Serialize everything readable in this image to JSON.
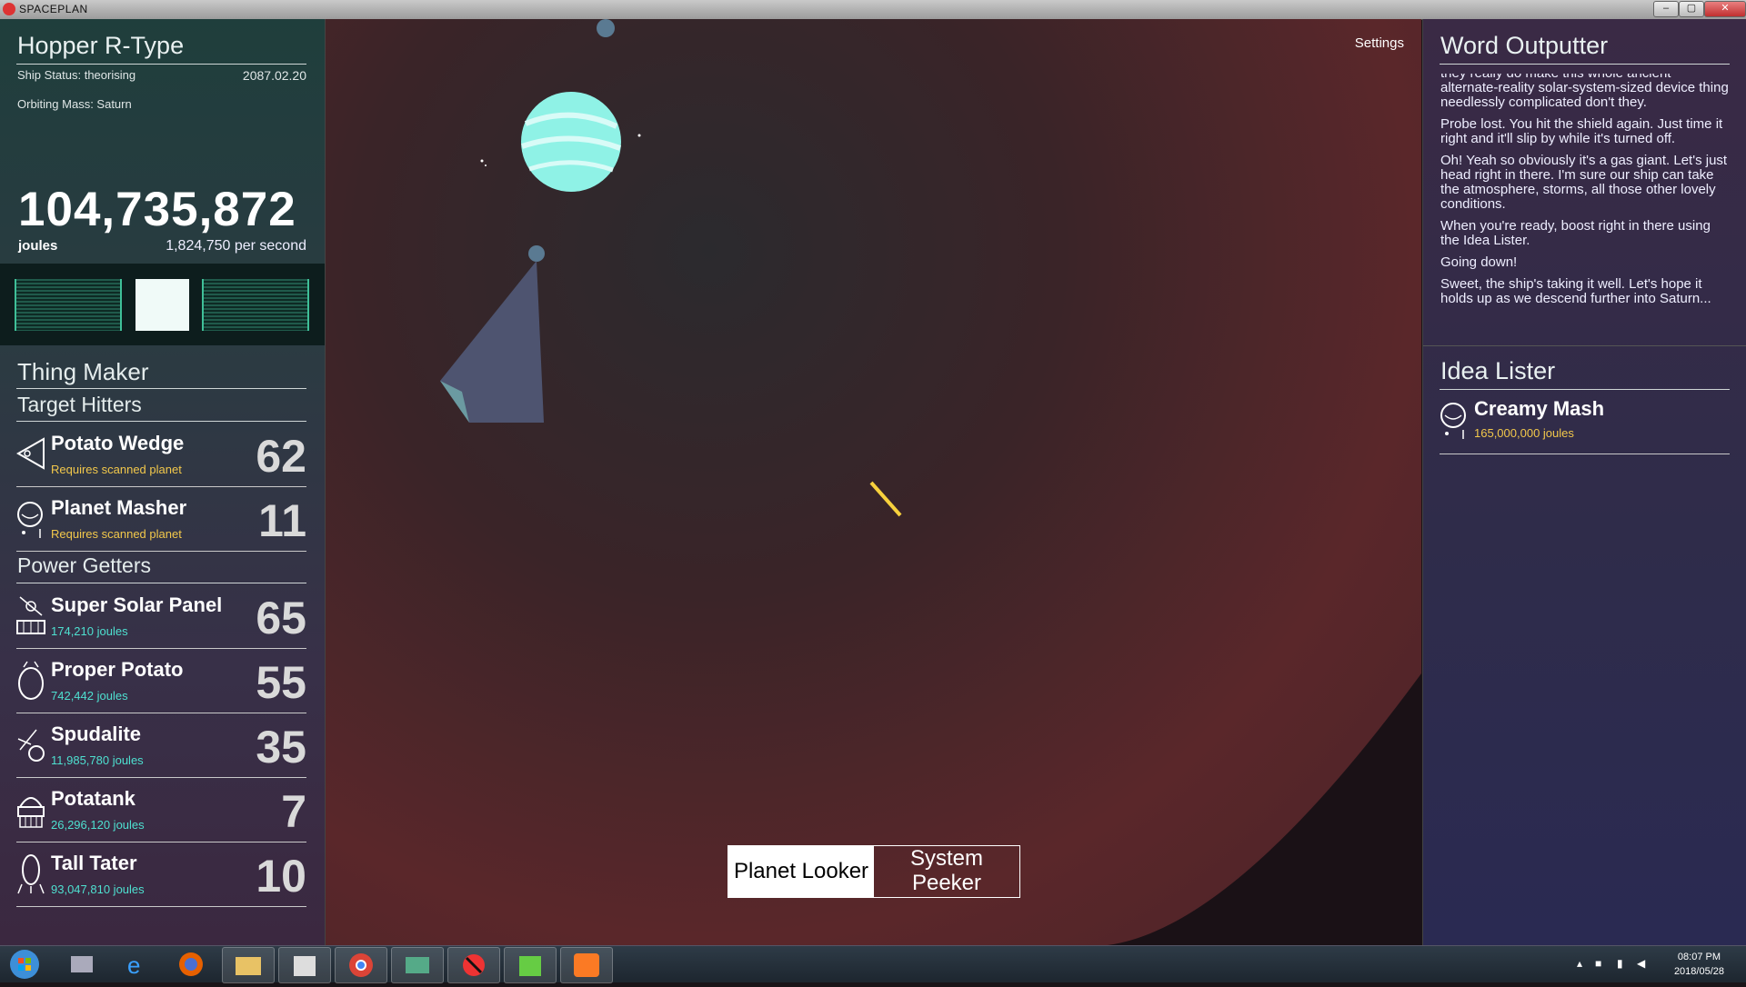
{
  "window": {
    "title": "SPACEPLAN",
    "controls": [
      "–",
      "▢",
      "✕"
    ]
  },
  "ship": {
    "name": "Hopper R-Type",
    "status": "Ship Status: theorising",
    "date": "2087.02.20",
    "orbiting": "Orbiting Mass: Saturn",
    "energy": "104,735,872",
    "energy_unit": "joules",
    "per_second": "1,824,750 per second"
  },
  "thing_maker": {
    "title": "Thing Maker",
    "target_hitters": {
      "title": "Target Hitters",
      "items": [
        {
          "name": "Potato Wedge",
          "sub": "Requires scanned planet",
          "count": "62",
          "icon": "potato-wedge-icon"
        },
        {
          "name": "Planet Masher",
          "sub": "Requires scanned planet",
          "count": "11",
          "icon": "planet-masher-icon"
        }
      ]
    },
    "power_getters": {
      "title": "Power Getters",
      "items": [
        {
          "name": "Super Solar Panel",
          "sub": "174,210 joules",
          "count": "65",
          "icon": "solar-panel-icon"
        },
        {
          "name": "Proper Potato",
          "sub": "742,442 joules",
          "count": "55",
          "icon": "proper-potato-icon"
        },
        {
          "name": "Spudalite",
          "sub": "11,985,780 joules",
          "count": "35",
          "icon": "spudalite-icon"
        },
        {
          "name": "Potatank",
          "sub": "26,296,120 joules",
          "count": "7",
          "icon": "potatank-icon"
        },
        {
          "name": "Tall Tater",
          "sub": "93,047,810 joules",
          "count": "10",
          "icon": "tall-tater-icon"
        }
      ]
    }
  },
  "main": {
    "settings_label": "Settings",
    "view_tabs": [
      "Planet Looker",
      "System Peeker"
    ]
  },
  "word_outputter": {
    "title": "Word Outputter",
    "messages": [
      "they really do make this whole ancient alternate-reality solar-system-sized device thing needlessly complicated don't they.",
      "Probe lost. You hit the shield again. Just time it right and it'll slip by while it's turned off.",
      "Oh! Yeah so obviously it's a gas giant. Let's just head right in there. I'm sure our ship can take the atmosphere, storms, all those other lovely conditions.",
      "When you're ready, boost right in there using the Idea Lister.",
      "Going down!",
      "Sweet, the ship's taking it well. Let's hope it holds up as we descend further into Saturn..."
    ]
  },
  "idea_lister": {
    "title": "Idea Lister",
    "items": [
      {
        "name": "Creamy Mash",
        "sub": "165,000,000 joules",
        "icon": "creamy-mash-icon"
      }
    ]
  },
  "taskbar": {
    "clock_time": "08:07 PM",
    "clock_date": "2018/05/28",
    "apps": [
      "start-orb-icon",
      "disk-cleanup-icon",
      "internet-explorer-icon",
      "firefox-icon",
      "file-explorer-icon",
      "media-icon",
      "chrome-icon",
      "window-tool-icon",
      "spaceplan-icon",
      "task-manager-icon",
      "xampp-icon"
    ]
  },
  "colors": {
    "accent_green": "#3fbf98",
    "joules_cyan": "#4ee0d0",
    "joules_gold": "#f2c84b"
  }
}
